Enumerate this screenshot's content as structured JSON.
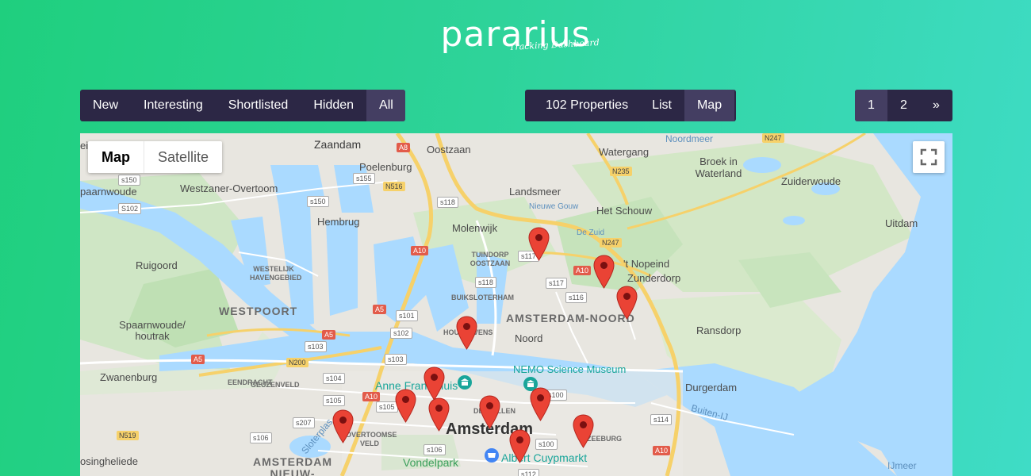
{
  "logo": {
    "word": "pararius",
    "tagline": "Tracking Dashboard"
  },
  "filters": [
    "New",
    "Interesting",
    "Shortlisted",
    "Hidden",
    "All"
  ],
  "filters_active": "All",
  "views": {
    "count": "102 Properties",
    "list": "List",
    "map": "Map",
    "active": "Map"
  },
  "pager": [
    "1",
    "2",
    "»"
  ],
  "pager_active": "1",
  "map": {
    "type_map": "Map",
    "type_satellite": "Satellite",
    "active_type": "Map",
    "labels": {
      "zaandam": "Zaandam",
      "oostzaan": "Oostzaan",
      "watergang": "Watergang",
      "noordmeer": "Noordmeer",
      "broek": "Broek in Waterland",
      "poelenburg": "Poelenburg",
      "landsmeer": "Landsmeer",
      "westzaner": "Westzaner-Overtoom",
      "zuiderwoude": "Zuiderwoude",
      "nieuwe_gouw": "Nieuwe Gouw",
      "het_schouw": "Het Schouw",
      "uitdam": "Uitdam",
      "hembrug": "Hembrug",
      "molenwijk": "Molenwijk",
      "de_zuid": "De Zuid",
      "ruigoord": "Ruigoord",
      "westelijk": "WESTELIJK HAVENGEBIED",
      "tuindorp": "TUINDORP OOSTZAAN",
      "nopeind": "'t Nopeind",
      "zunderdorp": "Zunderdorp",
      "westpoort": "WESTPOORT",
      "buiksloterham": "BUIKSLOTERHAM",
      "amsterdam_noord": "AMSTERDAM-NOORD",
      "spaarnwoude": "Spaarnwoude/ houtrak",
      "houthavens": "HOUTHAVENS",
      "noord": "Noord",
      "ransdorp": "Ransdorp",
      "zwanenburg": "Zwanenburg",
      "nemo": "NEMO Science Museum",
      "eendracht": "EENDRACHT",
      "geuzenveld": "GEUZENVELD",
      "anne_frank": "Anne Frank Huis",
      "durgerdam": "Durgerdam",
      "de_wallen": "DE WALLEN",
      "buiten_ij": "Buiten-IJ",
      "sloterplas": "Sloterplas",
      "overtoomse": "OVERTOOMSE VELD",
      "amsterdam": "Amsterdam",
      "zeeburg": "ZEEBURG",
      "vondelpark": "Vondelpark",
      "albert": "Albert Cuypmarkt",
      "amsterdam_nw": "AMSTERDAM NIEUW-WEST",
      "osingheliede": "osingheliede",
      "paarnwoude": "paarnwoude",
      "einde": "einde",
      "ijmeer": "IJmeer"
    },
    "roads": {
      "a8": "A8",
      "n247a": "N247",
      "n235": "N235",
      "n247b": "N247",
      "s150a": "s150",
      "s155": "s155",
      "n516": "N516",
      "s102a": "S102",
      "s150b": "s150",
      "s118a": "s118",
      "a10a": "A10",
      "s117a": "s117",
      "a10b": "A10",
      "s117b": "s117",
      "s118b": "s118",
      "s116": "s116",
      "a5a": "A5",
      "s101": "s101",
      "a5b": "A5",
      "s102b": "s102",
      "s103a": "s103",
      "s103b": "s103",
      "a5c": "A5",
      "n200": "N200",
      "s104": "s104",
      "s100a": "s100",
      "a10c": "A10",
      "s105a": "s105",
      "s105b": "s105",
      "s114": "s114",
      "s207": "s207",
      "s106a": "s106",
      "s100b": "s100",
      "n519": "N519",
      "s106b": "s106",
      "a10d": "A10",
      "s112": "s112"
    }
  },
  "colors": {
    "bar": "#2c2745",
    "bar_active": "#443e62",
    "water": "#aadaff",
    "park": "#c8e6c0",
    "land": "#e8e6e0",
    "pin": "#ea4335"
  }
}
